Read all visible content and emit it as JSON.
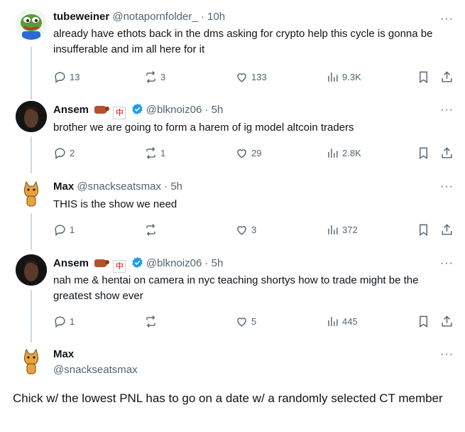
{
  "tweets": [
    {
      "name": "tubeweiner",
      "handle": "@notapornfolder_",
      "time": "10h",
      "text": "already have ethots back in the dms asking for crypto help this cycle is gonna be insufferable and im all here for it",
      "replies": "13",
      "retweets": "3",
      "likes": "133",
      "views": "9.3K",
      "avatar": "pepe-avatar"
    },
    {
      "name": "Ansem",
      "handle": "@blknoiz06",
      "time": "5h",
      "text": "brother we are going to form a harem of ig model altcoin traders",
      "replies": "2",
      "retweets": "1",
      "likes": "29",
      "views": "2.8K",
      "avatar": "ansem-avatar",
      "verified": true
    },
    {
      "name": "Max",
      "handle": "@snackseatsmax",
      "time": "5h",
      "text": "THIS is the show we need",
      "replies": "1",
      "retweets": "",
      "likes": "3",
      "views": "372",
      "avatar": "cat-avatar"
    },
    {
      "name": "Ansem",
      "handle": "@blknoiz06",
      "time": "5h",
      "text": "nah me & hentai on camera in nyc teaching shortys how to trade might be the greatest show ever",
      "replies": "1",
      "retweets": "",
      "likes": "5",
      "views": "445",
      "avatar": "ansem-avatar",
      "verified": true
    }
  ],
  "main": {
    "name": "Max",
    "handle": "@snackseatsmax",
    "text": "Chick w/ the lowest PNL has to go on a date w/ a randomly selected CT member"
  },
  "ui": {
    "more": "···",
    "sep": " · ",
    "emoji_zh": "中"
  },
  "colors": {
    "verified": "#1d9bf0",
    "muted": "#536471",
    "thread_line": "#cfd9de"
  }
}
